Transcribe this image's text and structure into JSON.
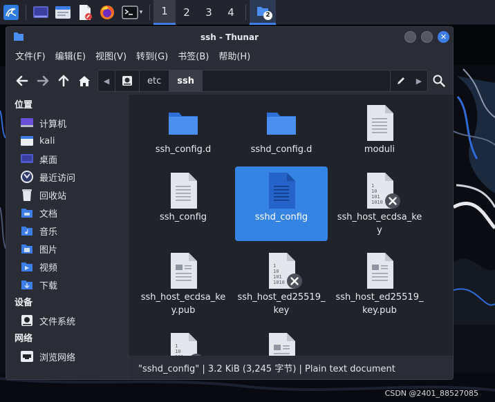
{
  "panel": {
    "workspaces": [
      "1",
      "2",
      "3",
      "4"
    ],
    "active_workspace": "1",
    "task_badge": "2",
    "launchers": [
      "kali-menu-icon",
      "show-desktop-icon",
      "file-manager-icon",
      "text-editor-icon",
      "firefox-icon",
      "terminal-icon"
    ]
  },
  "window": {
    "title": "ssh - Thunar",
    "menu": [
      "文件(F)",
      "编辑(E)",
      "视图(V)",
      "转到(G)",
      "书签(B)",
      "帮助(H)"
    ],
    "path": [
      "etc",
      "ssh"
    ]
  },
  "sidebar": {
    "sections": [
      {
        "heading": "位置",
        "items": [
          {
            "label": "计算机",
            "icon": "computer-icon"
          },
          {
            "label": "kali",
            "icon": "home-icon"
          },
          {
            "label": "桌面",
            "icon": "desktop-icon"
          },
          {
            "label": "最近访问",
            "icon": "recent-icon"
          },
          {
            "label": "回收站",
            "icon": "trash-icon"
          },
          {
            "label": "文档",
            "icon": "documents-icon"
          },
          {
            "label": "音乐",
            "icon": "music-icon"
          },
          {
            "label": "图片",
            "icon": "pictures-icon"
          },
          {
            "label": "视频",
            "icon": "videos-icon"
          },
          {
            "label": "下载",
            "icon": "downloads-icon"
          }
        ]
      },
      {
        "heading": "设备",
        "items": [
          {
            "label": "文件系统",
            "icon": "filesystem-icon"
          }
        ]
      },
      {
        "heading": "网络",
        "items": [
          {
            "label": "浏览网络",
            "icon": "network-icon"
          }
        ]
      }
    ]
  },
  "files": [
    {
      "name": "ssh_config.d",
      "kind": "folder",
      "locked": false,
      "selected": false
    },
    {
      "name": "sshd_config.d",
      "kind": "folder",
      "locked": false,
      "selected": false
    },
    {
      "name": "moduli",
      "kind": "text",
      "locked": false,
      "selected": false
    },
    {
      "name": "ssh_config",
      "kind": "text",
      "locked": false,
      "selected": false
    },
    {
      "name": "sshd_config",
      "kind": "text",
      "locked": false,
      "selected": true
    },
    {
      "name": "ssh_host_ecdsa_key",
      "kind": "binary",
      "locked": true,
      "selected": false
    },
    {
      "name": "ssh_host_ecdsa_key.pub",
      "kind": "doc",
      "locked": false,
      "selected": false
    },
    {
      "name": "ssh_host_ed25519_key",
      "kind": "binary",
      "locked": true,
      "selected": false
    },
    {
      "name": "ssh_host_ed25519_key.pub",
      "kind": "doc",
      "locked": false,
      "selected": false
    },
    {
      "name": "",
      "kind": "binary",
      "locked": true,
      "selected": false
    },
    {
      "name": "",
      "kind": "doc",
      "locked": false,
      "selected": false
    }
  ],
  "file_labels": {
    "f0": "ssh_config.d",
    "f1": "sshd_config.d",
    "f2": "moduli",
    "f3": "ssh_config",
    "f4": "sshd_config",
    "f5a": "ssh_host_ecdsa_ke",
    "f5b": "y",
    "f6a": "ssh_host_ecdsa_ke",
    "f6b": "y.pub",
    "f7a": "ssh_host_ed25519_",
    "f7b": "key",
    "f8a": "ssh_host_ed25519_",
    "f8b": "key.pub"
  },
  "status": "\"sshd_config\" | 3.2 KiB (3,245 字节) | Plain text document",
  "watermark": "CSDN @2401_88527085",
  "colors": {
    "accent": "#3584e4",
    "folder": "#3d7ee6",
    "panel": "#23252e",
    "window": "#2a2d36"
  }
}
